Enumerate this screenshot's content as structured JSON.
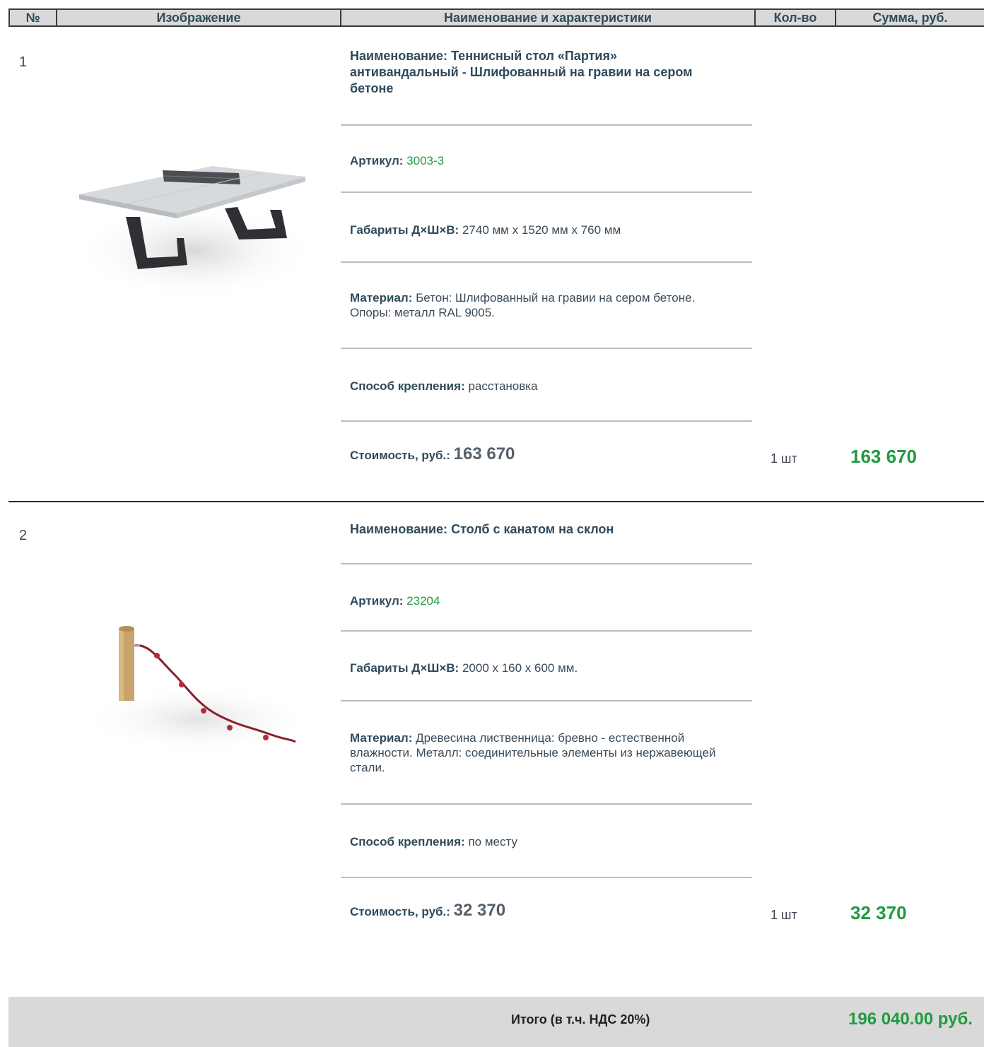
{
  "header": {
    "num": "№",
    "image": "Изображение",
    "name": "Наименование и характеристики",
    "qty": "Кол-во",
    "sum": "Сумма, руб."
  },
  "items": [
    {
      "num": "1",
      "image_icon": "ping-pong-table-image",
      "name_label": "Наименование:",
      "name": "Теннисный стол «Партия» антивандальный - Шлифованный на гравии на сером бетоне",
      "article_label": "Артикул:",
      "article": "3003-3",
      "dims_label": "Габариты Д×Ш×В:",
      "dims": "2740 мм x 1520 мм x 760 мм",
      "material_label": "Материал:",
      "material": "Бетон: Шлифованный на гравии на сером бетоне. Опоры: металл RAL 9005.",
      "mount_label": "Способ крепления:",
      "mount": "расстановка",
      "price_label": "Стоимость, руб.:",
      "price": "163 670",
      "qty": "1 шт",
      "sum": "163 670"
    },
    {
      "num": "2",
      "image_icon": "rope-post-image",
      "name_label": "Наименование:",
      "name": "Столб с канатом на склон",
      "article_label": "Артикул:",
      "article": "23204",
      "dims_label": "Габариты Д×Ш×В:",
      "dims": "2000 x 160 x 600 мм.",
      "material_label": "Материал:",
      "material": "Древесина лиственница: бревно - естественной влажности. Металл: соединительные элементы из нержавеющей стали.",
      "mount_label": "Способ крепления:",
      "mount": " по месту",
      "price_label": "Стоимость, руб.:",
      "price": "32 370",
      "qty": "1 шт",
      "sum": "32 370"
    }
  ],
  "total": {
    "label": "Итого (в т.ч. НДС 20%)",
    "value": "196 040.00 руб."
  },
  "colors": {
    "accent_green": "#1f9b3f",
    "header_bg": "#d9d9d9",
    "label_color": "#2f4a5c"
  }
}
